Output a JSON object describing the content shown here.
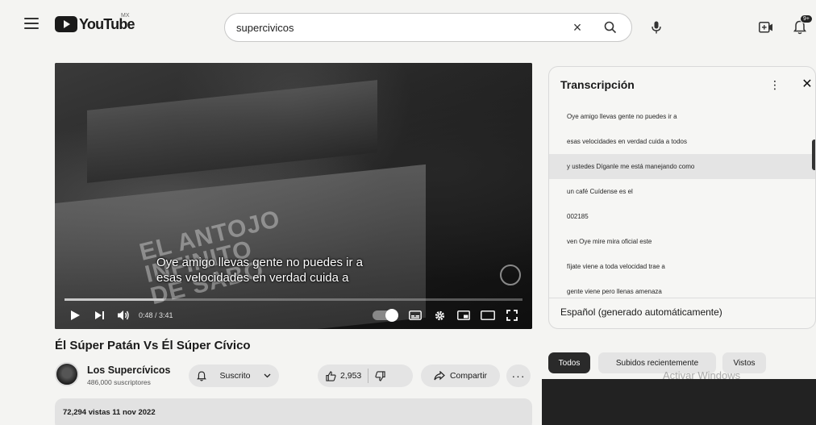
{
  "header": {
    "logo_text": "YouTube",
    "country_code": "MX",
    "search_value": "supercivicos",
    "notifications_badge": "9+"
  },
  "player": {
    "overlay_text_lines": [
      "EL ANTOJO",
      "INFINITO",
      "DE SABO"
    ],
    "caption_lines": [
      "Oye amigo llevas gente no puedes ir a",
      "esas velocidades en verdad cuida a"
    ],
    "time_display": "0:48 / 3:41",
    "progress": 0.217
  },
  "video": {
    "title": "Él Súper Patán Vs Él Súper Cívico",
    "channel_name": "Los Supercívicos",
    "subscribers": "486,000 suscriptores",
    "subscribe_label": "Suscrito",
    "likes": "2,953",
    "share_label": "Compartir",
    "more_label": "···",
    "views_date": "72,294 vistas  11 nov 2022"
  },
  "transcript": {
    "title": "Transcripción",
    "lines": [
      "Oye amigo llevas gente no puedes ir a",
      "esas velocidades en verdad cuida a todos",
      "y ustedes Díganle me está manejando como",
      "un café Cuídense es el",
      "002185",
      "ven Oye mire mira oficial este",
      "fíjate viene a toda velocidad trae a",
      "gente viene pero llenas amenaza"
    ],
    "active_index": 2,
    "language": "Español (generado automáticamente)"
  },
  "filters": {
    "chips": [
      "Todos",
      "Subidos recientemente",
      "Vistos"
    ],
    "selected": "Todos"
  },
  "system": {
    "watermark_text": "Activar Windows"
  },
  "colors": {
    "background": "#f4f4f2",
    "chip_selected": "#2a2a2a",
    "pill": "#e4e4e4"
  },
  "icons": {
    "menu": "hamburger-icon",
    "search": "search-icon",
    "clear": "close-icon",
    "mic": "mic-icon",
    "create": "create-video-icon",
    "bell": "bell-icon",
    "play": "play-icon",
    "next": "next-icon",
    "volume": "volume-icon",
    "captions": "subtitles-icon",
    "settings": "gear-icon",
    "miniplayer": "miniplayer-icon",
    "theater": "theater-icon",
    "fullscreen": "fullscreen-icon",
    "like": "thumbs-up-icon",
    "dislike": "thumbs-down-icon",
    "share": "share-icon"
  }
}
